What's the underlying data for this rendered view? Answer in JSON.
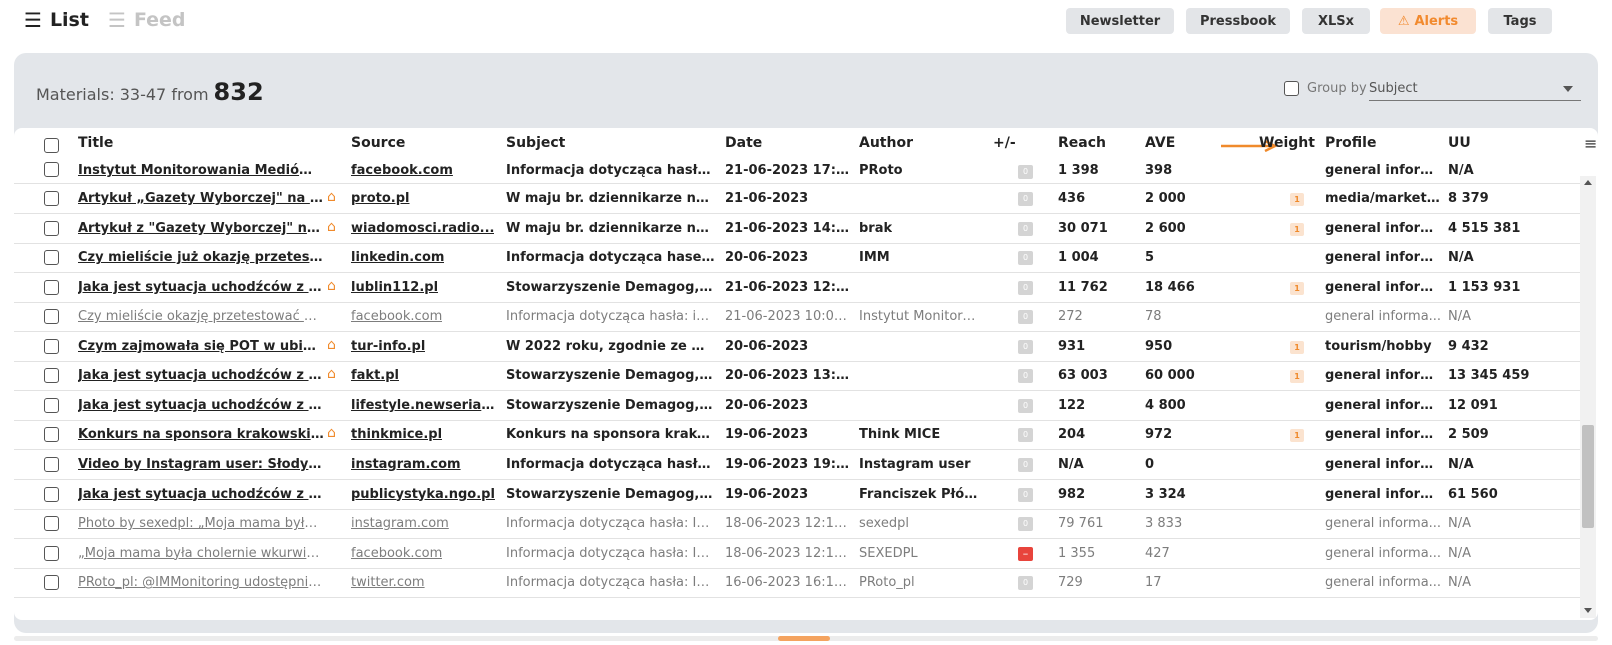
{
  "views": {
    "list_label": "List",
    "feed_label": "Feed"
  },
  "toolbar": {
    "newsletter": "Newsletter",
    "pressbook": "Pressbook",
    "xlsx": "XLSx",
    "alerts": "Alerts",
    "tags": "Tags"
  },
  "summary": {
    "prefix": "Materials:",
    "range": "33-47 from",
    "total": "832"
  },
  "group_by": {
    "label": "Group by",
    "selected": "Subject"
  },
  "columns": {
    "title": "Title",
    "source": "Source",
    "subject": "Subject",
    "date": "Date",
    "author": "Author",
    "plusminus": "+/-",
    "reach": "Reach",
    "ave": "AVE",
    "weight": "Weight",
    "profile": "Profile",
    "uu": "UU"
  },
  "colors": {
    "accent": "#f08a2b",
    "negative": "#e8443c",
    "panel": "#e3e6ea"
  },
  "rows": [
    {
      "title": "Instytut Monitorowania Mediów op...",
      "home": false,
      "source": "facebook.com",
      "subject": "Informacja dotycząca hasła: I...",
      "date": "21-06-2023 17:06:...",
      "author": "PRoto",
      "pm": "0",
      "neg": false,
      "reach": "1 398",
      "ave": "398",
      "weight": "",
      "profile": "general inform...",
      "uu": "N/A",
      "read": false
    },
    {
      "title": "Artykuł „Gazety Wyborczej\" na czel...",
      "home": true,
      "source": "proto.pl",
      "subject": "W maju br. dziennikarze najc...",
      "date": "21-06-2023",
      "author": "",
      "pm": "0",
      "neg": false,
      "reach": "436",
      "ave": "2 000",
      "weight": "1",
      "profile": "media/marketi...",
      "uu": "8 379",
      "read": false
    },
    {
      "title": "Artykuł z \"Gazety Wyborczej\" na cz...",
      "home": true,
      "source": "wiadomosci.radio...",
      "subject": "W maju br. dziennikarze najc...",
      "date": "21-06-2023 14:19:...",
      "author": "brak",
      "pm": "0",
      "neg": false,
      "reach": "30 071",
      "ave": "2 600",
      "weight": "1",
      "profile": "general inform...",
      "uu": "4 515 381",
      "read": false
    },
    {
      "title": "Czy mieliście już okazję przetestow...",
      "home": false,
      "source": "linkedin.com",
      "subject": "Informacja dotycząca haseł: i...",
      "date": "20-06-2023",
      "author": "IMM",
      "pm": "0",
      "neg": false,
      "reach": "1 004",
      "ave": "5",
      "weight": "",
      "profile": "general inform...",
      "uu": "N/A",
      "read": false
    },
    {
      "title": "Jaka jest sytuacja uchodźców z Uk...",
      "home": true,
      "source": "lublin112.pl",
      "subject": "Stowarzyszenie Demagog, wr...",
      "date": "21-06-2023 12:43:...",
      "author": "",
      "pm": "0",
      "neg": false,
      "reach": "11 762",
      "ave": "18 466",
      "weight": "1",
      "profile": "general inform...",
      "uu": "1 153 931",
      "read": false
    },
    {
      "title": "Czy mieliście okazję przetestować no...",
      "home": false,
      "source": "facebook.com",
      "subject": "Informacja dotycząca hasła: im...",
      "date": "21-06-2023 10:03:00",
      "author": "Instytut Monitoro...",
      "pm": "0",
      "neg": false,
      "reach": "272",
      "ave": "78",
      "weight": "",
      "profile": "general informa...",
      "uu": "N/A",
      "read": true
    },
    {
      "title": "Czym zajmowała się POT w ubiegły...",
      "home": true,
      "source": "tur-info.pl",
      "subject": "W 2022 roku, zgodnie ze wsk...",
      "date": "20-06-2023",
      "author": "",
      "pm": "0",
      "neg": false,
      "reach": "931",
      "ave": "950",
      "weight": "1",
      "profile": "tourism/hobby",
      "uu": "9 432",
      "read": false
    },
    {
      "title": "Jaka jest sytuacja uchodźców z Uk...",
      "home": true,
      "source": "fakt.pl",
      "subject": "Stowarzyszenie Demagog, wr...",
      "date": "20-06-2023 13:30...",
      "author": "",
      "pm": "0",
      "neg": false,
      "reach": "63 003",
      "ave": "60 000",
      "weight": "1",
      "profile": "general inform...",
      "uu": "13 345 459",
      "read": false
    },
    {
      "title": "Jaka jest sytuacja uchodźców z Uk...",
      "home": false,
      "source": "lifestyle.newseria.pl",
      "subject": "Stowarzyszenie Demagog, wr...",
      "date": "20-06-2023",
      "author": "",
      "pm": "0",
      "neg": false,
      "reach": "122",
      "ave": "4 800",
      "weight": "",
      "profile": "general inform...",
      "uu": "12 091",
      "read": false
    },
    {
      "title": "Konkurs na sponsora krakowskiej T...",
      "home": true,
      "source": "thinkmice.pl",
      "subject": "Konkurs na sponsora krakow...",
      "date": "19-06-2023",
      "author": "Think MICE",
      "pm": "0",
      "neg": false,
      "reach": "204",
      "ave": "972",
      "weight": "1",
      "profile": "general inform...",
      "uu": "2 509",
      "read": false
    },
    {
      "title": "Video by Instagram user: Słodycze ...",
      "home": false,
      "source": "instagram.com",
      "subject": "Informacja dotycząca hasła: i...",
      "date": "19-06-2023 19:23:...",
      "author": "Instagram user",
      "pm": "0",
      "neg": false,
      "reach": "N/A",
      "ave": "0",
      "weight": "",
      "profile": "general inform...",
      "uu": "N/A",
      "read": false
    },
    {
      "title": "Jaka jest sytuacja uchodźców z Uk...",
      "home": false,
      "source": "publicystyka.ngo.pl",
      "subject": "Stowarzyszenie Demagog, wr...",
      "date": "19-06-2023",
      "author": "Franciszek Płóci...",
      "pm": "0",
      "neg": false,
      "reach": "982",
      "ave": "3 324",
      "weight": "",
      "profile": "general inform...",
      "uu": "61 560",
      "read": false
    },
    {
      "title": "Photo by sexedpl: „Moja mama była c...",
      "home": false,
      "source": "instagram.com",
      "subject": "Informacja dotycząca hasła: IM...",
      "date": "18-06-2023 12:15:00",
      "author": "sexedpl",
      "pm": "0",
      "neg": false,
      "reach": "79 761",
      "ave": "3 833",
      "weight": "",
      "profile": "general informa...",
      "uu": "N/A",
      "read": true
    },
    {
      "title": "„Moja mama była cholernie wkurwio...",
      "home": false,
      "source": "facebook.com",
      "subject": "Informacja dotycząca hasła: IM...",
      "date": "18-06-2023 12:15:05",
      "author": "SEXEDPL",
      "pm": "–",
      "neg": true,
      "reach": "1 355",
      "ave": "427",
      "weight": "",
      "profile": "general informa...",
      "uu": "N/A",
      "read": true
    },
    {
      "title": "PRoto_pl: @IMMonitoring udostępnił...",
      "home": false,
      "source": "twitter.com",
      "subject": "Informacja dotycząca hasła: IM...",
      "date": "16-06-2023 16:16:11",
      "author": "PRoto_pl",
      "pm": "0",
      "neg": false,
      "reach": "729",
      "ave": "17",
      "weight": "",
      "profile": "general informa...",
      "uu": "N/A",
      "read": true
    }
  ]
}
